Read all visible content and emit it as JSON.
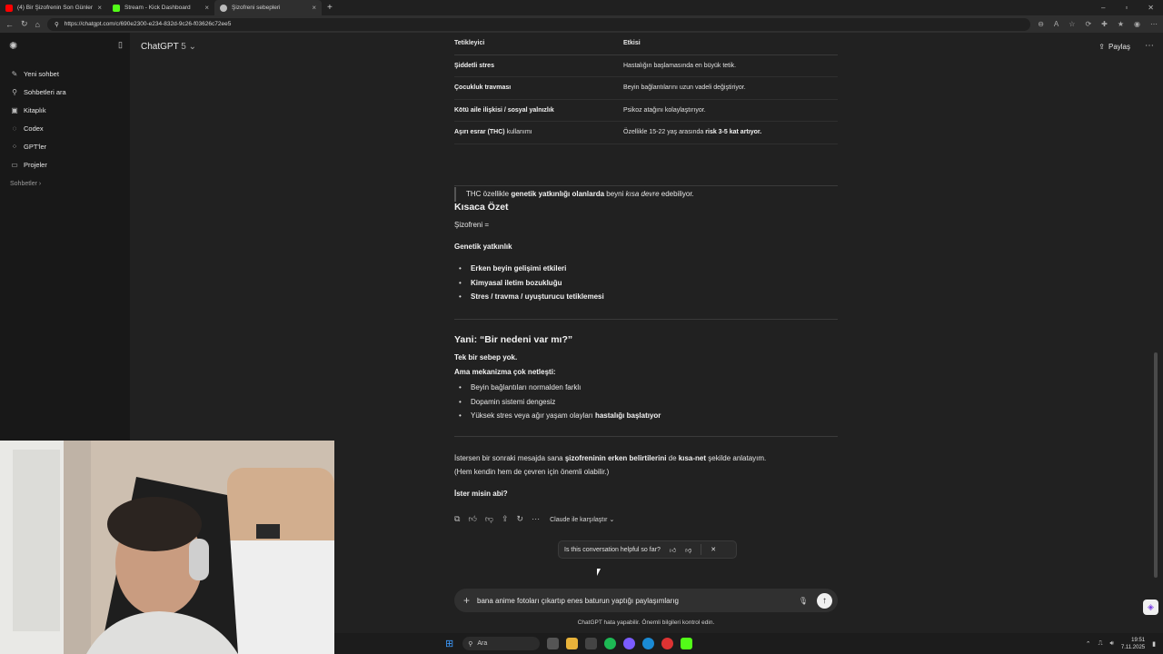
{
  "browser": {
    "tabs": [
      {
        "title": "(4) Bir Şizofrenin Son Günleri - Yo",
        "color": "#ff0000"
      },
      {
        "title": "Stream - Kick Dashboard",
        "color": "#53fc18"
      },
      {
        "title": "Şizofreni sebepleri",
        "color": "#bbbbbb"
      }
    ],
    "url": "https://chatgpt.com/c/690e2300-e234-832d-9c26-f03626c72ee5"
  },
  "sidebar": {
    "items": [
      {
        "label": "Yeni sohbet",
        "icon": "edit-icon"
      },
      {
        "label": "Sohbetleri ara",
        "icon": "search-icon"
      },
      {
        "label": "Kitaplık",
        "icon": "library-icon"
      },
      {
        "label": "Codex",
        "icon": "codex-icon"
      },
      {
        "label": "GPT'ler",
        "icon": "gpts-icon"
      },
      {
        "label": "Projeler",
        "icon": "folder-icon"
      }
    ],
    "section": "Sohbetler"
  },
  "header": {
    "model": "ChatGPT",
    "version": "5",
    "share": "Paylaş"
  },
  "table": {
    "headers": [
      "Tetikleyici",
      "Etkisi"
    ],
    "rows": [
      {
        "trigger": "Şiddetli stres",
        "effect": "Hastalığın başlamasında en büyük tetik."
      },
      {
        "trigger": "Çocukluk travması",
        "effect": "Beyin bağlantılarını uzun vadeli değiştiriyor."
      },
      {
        "trigger": "Kötü aile ilişkisi / sosyal yalnızlık",
        "effect": "Psikoz atağını kolaylaştırıyor."
      },
      {
        "trigger_bold": "Aşırı esrar (THC)",
        "trigger_rest": " kullanımı",
        "effect_pre": "Özellikle 15-22 yaş arasında ",
        "effect_bold": "risk 3-5 kat artıyor."
      }
    ]
  },
  "quote": {
    "pre": "THC özellikle ",
    "bold": "genetik yatkınlığı olanlarda",
    "mid": " beyni ",
    "ital": "kısa devre",
    "post": " edebiliyor."
  },
  "summary": {
    "title": "Kısaca Özet",
    "line": "Şizofreni =",
    "genetic": "Genetik yatkınlık",
    "bullets": [
      "Erken beyin gelişimi etkileri",
      "Kimyasal iletim bozukluğu",
      "Stres / travma / uyuşturucu tetiklemesi"
    ]
  },
  "reason": {
    "title": "Yani: “Bir nedeni var mı?”",
    "line1": "Tek bir sebep yok.",
    "line2": "Ama mekanizma çok netleşti:",
    "bullets": [
      "Beyin bağlantıları normalden farklı",
      "Dopamin sistemi dengesiz"
    ],
    "bullet3_pre": "Yüksek stres veya ağır yaşam olayları ",
    "bullet3_bold": "hastalığı başlatıyor"
  },
  "closing": {
    "pre": "İstersen bir sonraki mesajda sana ",
    "bold1": "şizofreninin erken belirtilerini",
    "mid": " de ",
    "bold2": "kısa-net",
    "post": " şekilde anlatayım.",
    "line2": "(Hem kendin hem de çevren için önemli olabilir.)",
    "question": "İster misin abi?"
  },
  "actions": {
    "compare": "Claude ile karşılaştır"
  },
  "feedback": {
    "question": "Is this conversation helpful so far?"
  },
  "composer": {
    "value": "bana anime fotoları çıkartıp enes baturun yaptığı paylaşımlarıg"
  },
  "disclaimer": "ChatGPT hata yapabilir. Önemli bilgileri kontrol edin.",
  "taskbar": {
    "search": "Ara",
    "time": "19:51",
    "date": "7.11.2025"
  }
}
